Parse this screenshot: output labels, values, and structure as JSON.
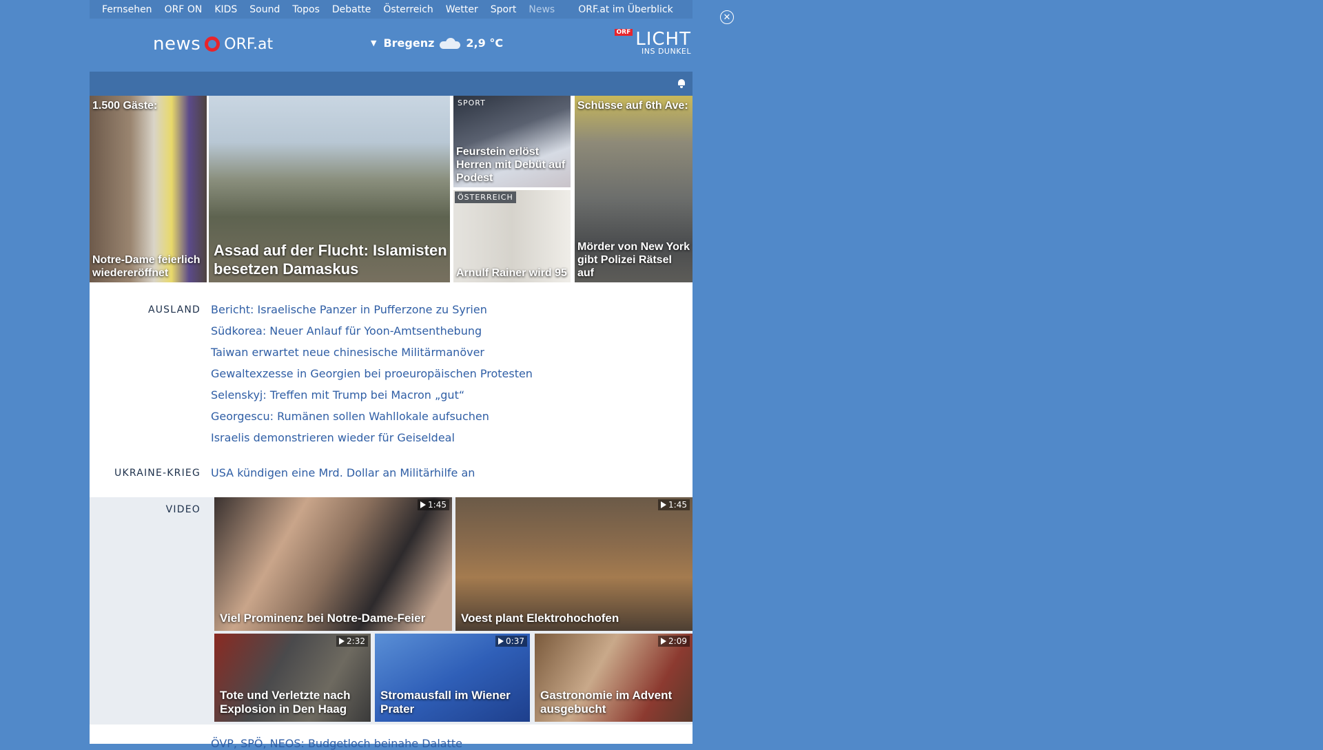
{
  "nav": {
    "items": [
      "Fernsehen",
      "ORF ON",
      "KIDS",
      "Sound",
      "Topos",
      "Debatte",
      "Österreich",
      "Wetter",
      "Sport",
      "News"
    ],
    "active": "News",
    "overview": "ORF.at im Überblick"
  },
  "close_icon": "close-circle-icon",
  "logo": {
    "news": "news",
    "orf": "ORF.at"
  },
  "weather": {
    "location": "Bregenz",
    "temp": "2,9 °C",
    "icon": "cloud-icon"
  },
  "licht": {
    "badge": "ORF",
    "big": "LICHT",
    "small": "INS DUNKEL"
  },
  "tiles": [
    {
      "top": "1.500 Gäste:",
      "caption": "Notre-Dame feierlich wiedereröffnet"
    },
    {
      "caption": "Assad auf der Flucht: Islamisten besetzen Damaskus"
    },
    {
      "tag": "SPORT",
      "caption": "Feurstein erlöst Herren mit Debüt auf Podest"
    },
    {
      "tag": "ÖSTERREICH",
      "caption": "Arnulf Rainer wird 95"
    },
    {
      "top": "Schüsse auf 6th Ave:",
      "caption": "Mörder von New York gibt Polizei Rätsel auf"
    }
  ],
  "sections": {
    "ausland": {
      "label": "AUSLAND",
      "links": [
        "Bericht: Israelische Panzer in Pufferzone zu Syrien",
        "Südkorea: Neuer Anlauf für Yoon-Amtsenthebung",
        "Taiwan erwartet neue chinesische Militärmanöver",
        "Gewaltexzesse in Georgien bei proeuropäischen Protesten",
        "Selenskyj: Treffen mit Trump bei Macron „gut“",
        "Georgescu: Rumänen sollen Wahllokale aufsuchen",
        "Israelis demonstrieren wieder für Geiseldeal"
      ]
    },
    "ukraine": {
      "label": "UKRAINE-KRIEG",
      "links": [
        "USA kündigen eine Mrd. Dollar an Militärhilfe an"
      ]
    },
    "video": {
      "label": "VIDEO",
      "items": [
        {
          "caption": "Viel Prominenz bei Notre-Dame-Feier",
          "duration": "1:45"
        },
        {
          "caption": "Voest plant Elektrohochofen",
          "duration": "1:45"
        },
        {
          "caption": "Tote und Verletzte nach Explosion in Den Haag",
          "duration": "2:32"
        },
        {
          "caption": "Stromausfall im Wiener Prater",
          "duration": "0:37"
        },
        {
          "caption": "Gastronomie im Advent ausgebucht",
          "duration": "2:09"
        }
      ]
    }
  },
  "bottom_partial": "ÖVP, SPÖ, NEOS: Budgetloch beinahe Dalatte"
}
